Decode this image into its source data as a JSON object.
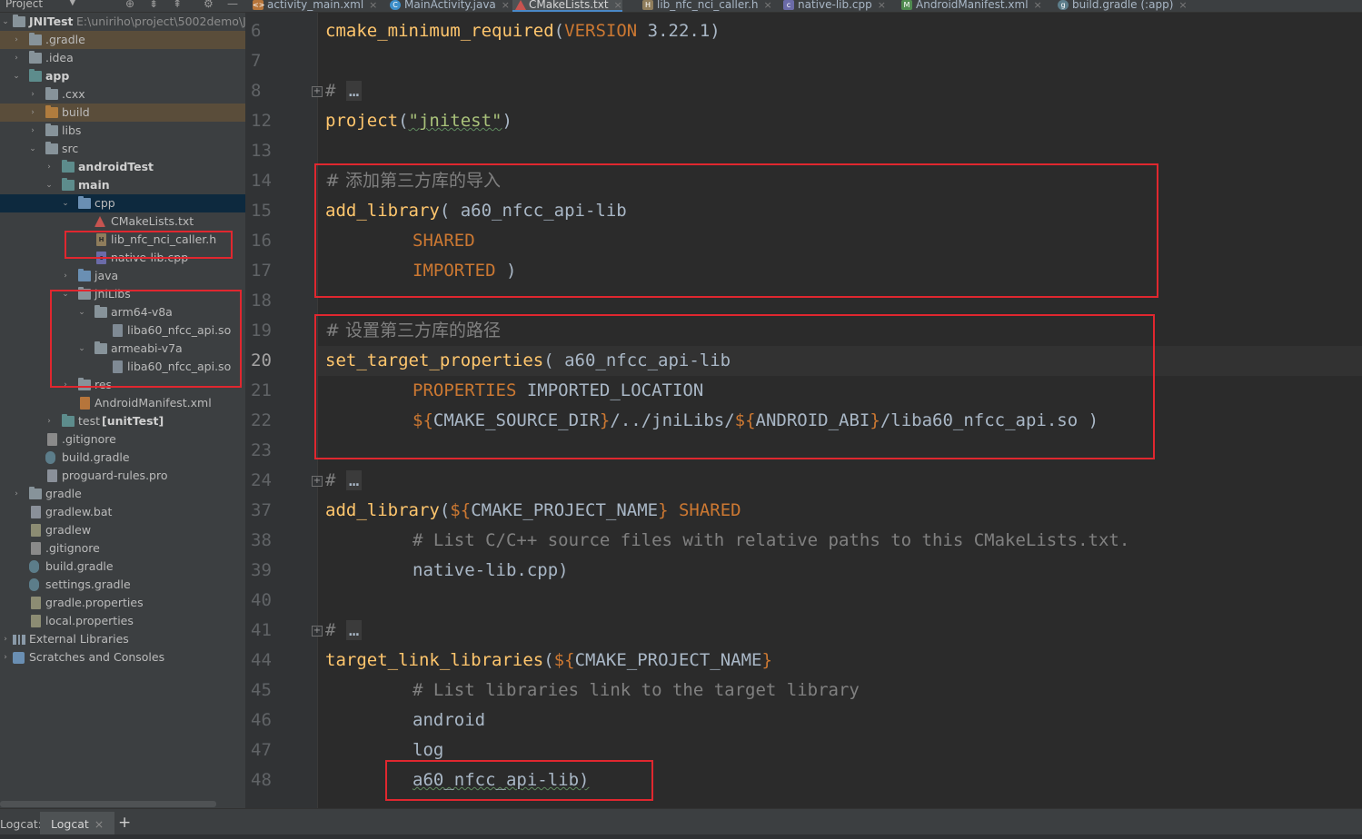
{
  "project_toolbar": {
    "label": "Project",
    "dropdown_glyph": "▼",
    "icons": [
      "globe-icon",
      "collapse-all-icon",
      "expand-all-icon",
      "settings-icon",
      "minimize-icon"
    ]
  },
  "tabs": [
    {
      "label": "activity_main.xml",
      "icon": "xml-file-icon",
      "active": false
    },
    {
      "label": "MainActivity.java",
      "icon": "java-class-icon",
      "active": false
    },
    {
      "label": "CMakeLists.txt",
      "icon": "cmake-icon",
      "active": true
    },
    {
      "label": "lib_nfc_nci_caller.h",
      "icon": "header-file-icon",
      "active": false
    },
    {
      "label": "native-lib.cpp",
      "icon": "cpp-file-icon",
      "active": false
    },
    {
      "label": "AndroidManifest.xml",
      "icon": "manifest-icon",
      "active": false
    },
    {
      "label": "build.gradle (:app)",
      "icon": "gradle-icon",
      "active": false
    }
  ],
  "tree": {
    "root_name": "JNITest",
    "root_path": "E:\\uniriho\\project\\5002demo\\JN",
    "items": [
      {
        "label": ".gradle"
      },
      {
        "label": ".idea"
      },
      {
        "label": "app"
      },
      {
        "label": ".cxx"
      },
      {
        "label": "build"
      },
      {
        "label": "libs"
      },
      {
        "label": "src"
      },
      {
        "label": "androidTest"
      },
      {
        "label": "main"
      },
      {
        "label": "cpp"
      },
      {
        "label": "CMakeLists.txt"
      },
      {
        "label": "lib_nfc_nci_caller.h"
      },
      {
        "label": "native-lib.cpp"
      },
      {
        "label": "java"
      },
      {
        "label": "jniLibs"
      },
      {
        "label": "arm64-v8a"
      },
      {
        "label": "liba60_nfcc_api.so"
      },
      {
        "label": "armeabi-v7a"
      },
      {
        "label": "liba60_nfcc_api.so"
      },
      {
        "label": "res"
      },
      {
        "label": "AndroidManifest.xml"
      },
      {
        "label": "test",
        "suffix": "[unitTest]"
      },
      {
        "label": ".gitignore"
      },
      {
        "label": "build.gradle"
      },
      {
        "label": "proguard-rules.pro"
      },
      {
        "label": "gradle"
      },
      {
        "label": "gradlew.bat"
      },
      {
        "label": "gradlew"
      },
      {
        "label": ".gitignore"
      },
      {
        "label": "build.gradle"
      },
      {
        "label": "settings.gradle"
      },
      {
        "label": "gradle.properties"
      },
      {
        "label": "local.properties"
      },
      {
        "label": "External Libraries"
      },
      {
        "label": "Scratches and Consoles"
      }
    ]
  },
  "editor": {
    "line_numbers": [
      "6",
      "7",
      "8",
      "12",
      "13",
      "14",
      "15",
      "16",
      "17",
      "18",
      "19",
      "20",
      "21",
      "22",
      "23",
      "24",
      "37",
      "38",
      "39",
      "40",
      "41",
      "44",
      "45",
      "46",
      "47",
      "48"
    ],
    "current_line": "20",
    "folded_placeholder": "…",
    "lines": {
      "l6_fn": "cmake_minimum_required",
      "l6_open": "(",
      "l6_kw": "VERSION",
      "l6_rest": " 3.22.1)",
      "fold_hash": "#",
      "l12_fn": "project",
      "l12_open": "(",
      "l12_str": "\"jnitest\"",
      "l12_close": ")",
      "l14_comment": "# 添加第三方库的导入",
      "l15_fn": "add_library",
      "l15_rest": "( a60_nfcc_api-lib",
      "l16_kw": "SHARED",
      "l17_kw": "IMPORTED",
      "l17_rest": " )",
      "l19_comment": "# 设置第三方库的路径",
      "l20_fn": "set_target_properties",
      "l20_rest": "( a60_nfcc_api-lib",
      "l21_kw": "PROPERTIES",
      "l21_rest": " IMPORTED_LOCATION",
      "l22_a": "${",
      "l22_b": "CMAKE_SOURCE_DIR",
      "l22_c": "}",
      "l22_d": "/../jniLibs/",
      "l22_e": "${",
      "l22_f": "ANDROID_ABI",
      "l22_g": "}",
      "l22_h": "/liba60_nfcc_api.so )",
      "l37_fn": "add_library",
      "l37_open": "(",
      "l37_a": "${",
      "l37_b": "CMAKE_PROJECT_NAME",
      "l37_c": "}",
      "l37_kw": " SHARED",
      "l38_comment": "# List C/C++ source files with relative paths to this CMakeLists.txt.",
      "l39": "native-lib.cpp)",
      "l44_fn": "target_link_libraries",
      "l44_open": "(",
      "l44_a": "${",
      "l44_b": "CMAKE_PROJECT_NAME",
      "l44_c": "}",
      "l45_comment": "# List libraries link to the target library",
      "l46": "android",
      "l47": "log",
      "l48": "a60_nfcc_api-lib)"
    }
  },
  "bottom": {
    "logcat_label": "Logcat:",
    "tab_label": "Logcat",
    "close_glyph": "×",
    "add_glyph": "+"
  }
}
